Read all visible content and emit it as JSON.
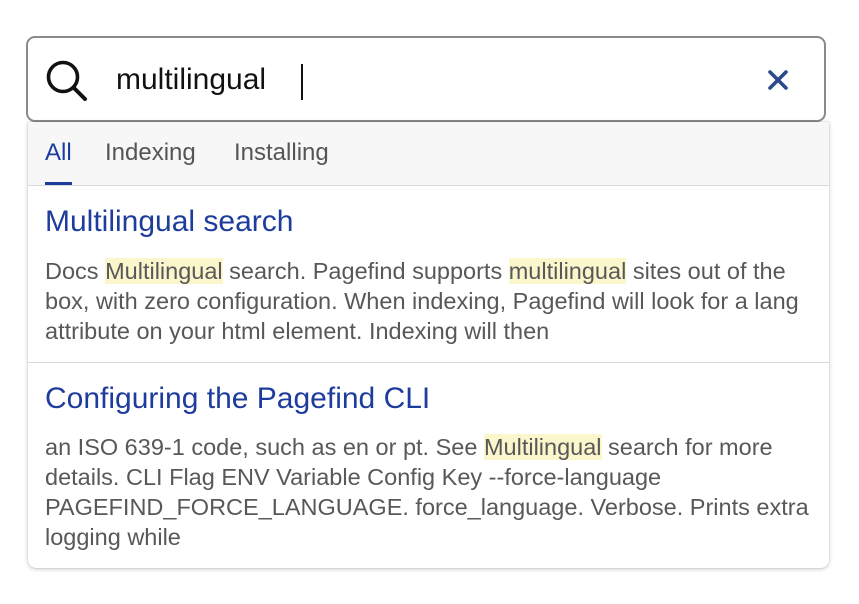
{
  "search": {
    "value": "multilingual",
    "clear_label": "Clear search"
  },
  "tabs": [
    {
      "label": "All",
      "active": true
    },
    {
      "label": "Indexing",
      "active": false
    },
    {
      "label": "Installing",
      "active": false
    }
  ],
  "results": [
    {
      "title": "Multilingual search",
      "excerpt": {
        "p1": "Docs ",
        "h1": "Multilingual",
        "p2": " search. Pagefind supports ",
        "h2": "multilingual",
        "p3": " sites out of the box, with zero configuration. When indexing, Pagefind will look for a lang attribute on your html element. Indexing will then"
      }
    },
    {
      "title": "Configuring the Pagefind CLI",
      "excerpt": {
        "p1": "an ISO 639-1 code, such as en or pt. See ",
        "h1": "Multilingual",
        "p2": " search for more details. CLI Flag ENV Variable Config Key --force-language PAGEFIND_FORCE_LANGUAGE. force_language. Verbose. Prints extra logging while"
      }
    }
  ],
  "colors": {
    "link": "#1d3c9c",
    "highlight": "#fbf6cc",
    "excerpt_text": "#585858",
    "clear_icon": "#2c4a8a"
  }
}
